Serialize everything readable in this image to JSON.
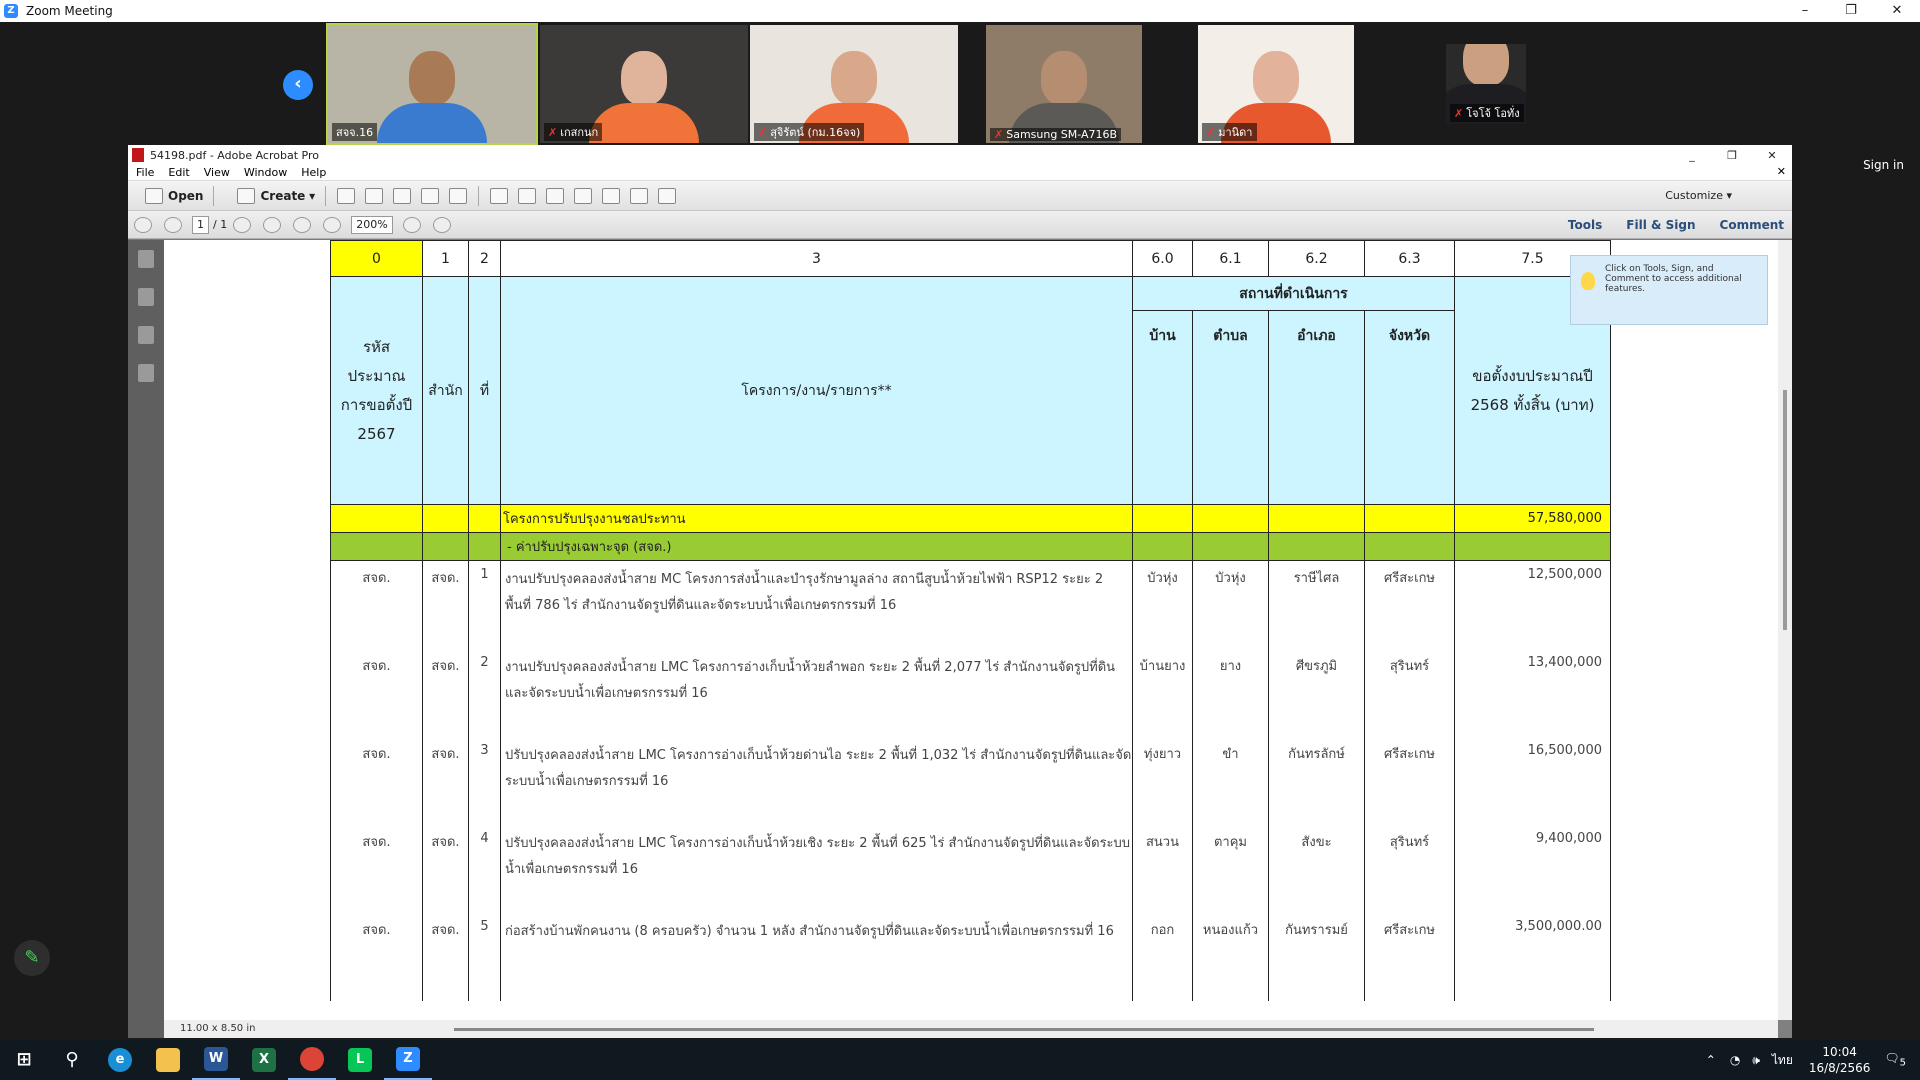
{
  "zoom": {
    "window_title": "Zoom Meeting",
    "sign_in": "Sign in",
    "participants": [
      {
        "name": "สจจ.16",
        "muted": false,
        "scene": "#b9b5a6",
        "shirt": "#3a7bd0",
        "skin": "#a87a55"
      },
      {
        "name": "เกสกนก",
        "muted": true,
        "scene": "#3c3a38",
        "shirt": "#f0743a",
        "skin": "#e0b49a"
      },
      {
        "name": "สุจิรัตน์ (กม.16จจ)",
        "muted": true,
        "scene": "#e9e4dd",
        "shirt": "#f06a3a",
        "skin": "#d9a88a"
      },
      {
        "name": "Samsung SM-A716B",
        "muted": true,
        "scene": "#8e7b68",
        "shirt": "#5c5a56",
        "skin": "#b58e72"
      },
      {
        "name": "มานิดา",
        "muted": true,
        "scene": "#f3efe8",
        "shirt": "#e8582f",
        "skin": "#e2b29a"
      },
      {
        "name": "โจโจ้ โอทั่ง",
        "muted": true,
        "scene": "#2a2a2a",
        "shirt": "#1e1e22",
        "skin": "#caa080"
      }
    ]
  },
  "acrobat": {
    "title": "54198.pdf - Adobe Acrobat Pro",
    "menu": [
      "File",
      "Edit",
      "View",
      "Window",
      "Help"
    ],
    "toolbar": {
      "open": "Open",
      "create": "Create",
      "customize": "Customize"
    },
    "nav": {
      "page": "1",
      "page_total": "/ 1",
      "zoom": "200%"
    },
    "panels": {
      "tools": "Tools",
      "fill_sign": "Fill & Sign",
      "comment": "Comment"
    },
    "tip": "Click on Tools, Sign, and Comment to access additional features.",
    "page_size": "11.00 x 8.50 in"
  },
  "table": {
    "col_numbers": [
      "0",
      "1",
      "2",
      "3",
      "6.0",
      "6.1",
      "6.2",
      "6.3",
      "7.5"
    ],
    "h_code": "รหัส ประมาณ การขอตั้งปี 2567",
    "h_office": "สำนัก",
    "h_no": "ที่",
    "h_project": "โครงการ/งาน/รายการ**",
    "h_location": "สถานที่ดำเนินการ",
    "h_village": "บ้าน",
    "h_subdistrict": "ตำบล",
    "h_district": "อำเภอ",
    "h_province": "จังหวัด",
    "h_budget": "ขอตั้งงบประมาณปี 2568 ทั้งสิ้น (บาท)",
    "group_title": "โครงการปรับปรุงงานชลประทาน",
    "group_total": "57,580,000",
    "sub_title": "- ค่าปรับปรุงเฉพาะจุด (สจด.)",
    "rows": [
      {
        "code": "สจด.",
        "office": "สจด.",
        "no": "1",
        "desc": "งานปรับปรุงคลองส่งน้ำสาย MC โครงการส่งน้ำและบำรุงรักษามูลล่าง สถานีสูบน้ำห้วยไฟฟ้า RSP12 ระยะ 2 พื้นที่ 786 ไร่ สำนักงานจัดรูปที่ดินและจัดระบบน้ำเพื่อเกษตรกรรมที่ 16",
        "village": "บัวหุ่ง",
        "subdistrict": "บัวหุ่ง",
        "district": "ราษีไศล",
        "province": "ศรีสะเกษ",
        "amount": "12,500,000"
      },
      {
        "code": "สจด.",
        "office": "สจด.",
        "no": "2",
        "desc": "งานปรับปรุงคลองส่งน้ำสาย LMC โครงการอ่างเก็บน้ำห้วยลำพอก ระยะ 2 พื้นที่ 2,077 ไร่ สำนักงานจัดรูปที่ดินและจัดระบบน้ำเพื่อเกษตรกรรมที่ 16",
        "village": "บ้านยาง",
        "subdistrict": "ยาง",
        "district": "ศีขรภูมิ",
        "province": "สุรินทร์",
        "amount": "13,400,000"
      },
      {
        "code": "สจด.",
        "office": "สจด.",
        "no": "3",
        "desc": "ปรับปรุงคลองส่งน้ำสาย LMC โครงการอ่างเก็บน้ำห้วยด่านไอ ระยะ 2 พื้นที่ 1,032 ไร่ สำนักงานจัดรูปที่ดินและจัดระบบน้ำเพื่อเกษตรกรรมที่ 16",
        "village": "ทุ่งยาว",
        "subdistrict": "ขำ",
        "district": "กันทรลักษ์",
        "province": "ศรีสะเกษ",
        "amount": "16,500,000"
      },
      {
        "code": "สจด.",
        "office": "สจด.",
        "no": "4",
        "desc": "ปรับปรุงคลองส่งน้ำสาย LMC โครงการอ่างเก็บน้ำห้วยเชิง ระยะ 2 พื้นที่ 625 ไร่ สำนักงานจัดรูปที่ดินและจัดระบบน้ำเพื่อเกษตรกรรมที่ 16",
        "village": "สนวน",
        "subdistrict": "ตาคุม",
        "district": "สังขะ",
        "province": "สุรินทร์",
        "amount": "9,400,000"
      },
      {
        "code": "สจด.",
        "office": "สจด.",
        "no": "5",
        "desc": "ก่อสร้างบ้านพักคนงาน (8 ครอบครัว) จำนวน 1 หลัง สำนักงานจัดรูปที่ดินและจัดระบบน้ำเพื่อเกษตรกรรมที่ 16",
        "village": "กอก",
        "subdistrict": "หนองแก้ว",
        "district": "กันทรารมย์",
        "province": "ศรีสะเกษ",
        "amount": "3,500,000.00"
      }
    ]
  },
  "taskbar": {
    "time": "10:04",
    "date": "16/8/2566",
    "lang": "ไทย",
    "notifications": "5"
  }
}
